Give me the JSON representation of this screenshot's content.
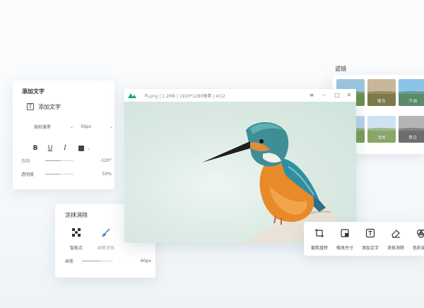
{
  "text_panel": {
    "title": "添加文字",
    "add_text_label": "添加文字",
    "font_family": "微软雅黑",
    "font_size": "56px",
    "format_buttons": [
      "B",
      "U",
      "I"
    ],
    "text_color": "#444444",
    "direction_label": "方向",
    "direction_value": "-120°",
    "direction_level": 0.55,
    "opacity_label": "透明度",
    "opacity_value": "50%",
    "opacity_level": 0.5
  },
  "erase_panel": {
    "title": "涂抹消除",
    "smart_tool_label": "智能点",
    "brush_tool_label": "画笔涂抹",
    "size_label": "画笔",
    "size_value": "60px",
    "size_level": 0.6
  },
  "filter_panel": {
    "title": "滤镜",
    "thumbs": [
      {
        "caption": "",
        "sky": "#9cc6e0",
        "land": "#6a8f4c"
      },
      {
        "caption": "暖色",
        "sky": "#c8b79a",
        "land": "#7d7a4a"
      },
      {
        "caption": "冷调",
        "sky": "#8cc4e8",
        "land": "#5b8c6a"
      },
      {
        "caption": "",
        "sky": "#b7d4e6",
        "land": "#7b9a55"
      },
      {
        "caption": "清新",
        "sky": "#cfe2ef",
        "land": "#89a868"
      },
      {
        "caption": "黑白",
        "sky": "#b4b4b4",
        "land": "#6e6e6e"
      }
    ]
  },
  "main_window": {
    "file_info": "鸟.png | 1.2MB | 1920*1280像素 | 4/12",
    "accent": "#1aa67a"
  },
  "action_bar": {
    "crop_label": "裁剪旋转",
    "resize_label": "修改尺寸",
    "text_label": "添加文字",
    "erase_label": "涂抹消除",
    "color_label": "色彩调节"
  }
}
